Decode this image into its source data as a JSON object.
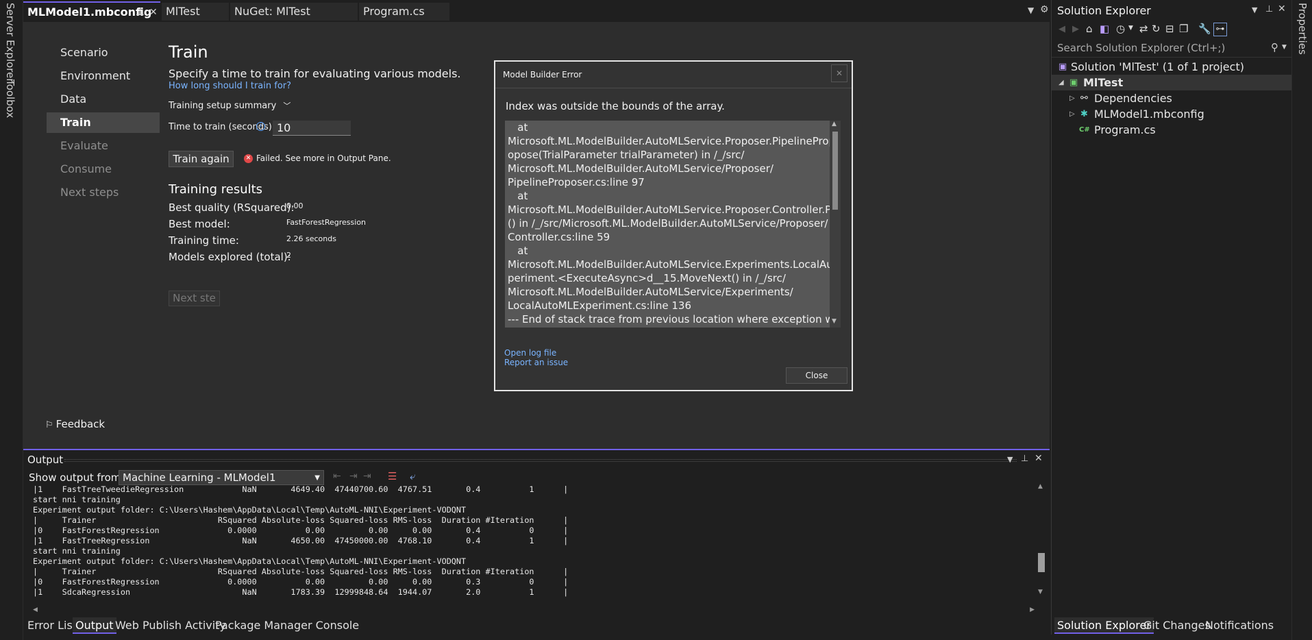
{
  "left_strip": {
    "server_explorer": "Server Explorer",
    "toolbox": "Toolbox"
  },
  "right_strip": {
    "properties": "Properties"
  },
  "doc_tabs": [
    {
      "label": "MLModel1.mbconfig"
    },
    {
      "label": "MlTest"
    },
    {
      "label": "NuGet: MlTest"
    },
    {
      "label": "Program.cs"
    }
  ],
  "nav": {
    "items": [
      "Scenario",
      "Environment",
      "Data",
      "Train",
      "Evaluate",
      "Consume",
      "Next steps"
    ]
  },
  "train": {
    "title": "Train",
    "subtitle": "Specify a time to train for evaluating various models.",
    "help_link": "How long should I train for?",
    "summary_toggle": "Training setup summary",
    "time_label": "Time to train (seconds):",
    "time_value": "10",
    "train_again": "Train again",
    "status": "Failed. See more in Output Pane.",
    "results_title": "Training results",
    "results": [
      {
        "label": "Best quality (RSquared):",
        "value": "0.00"
      },
      {
        "label": "Best model:",
        "value": "FastForestRegression"
      },
      {
        "label": "Training time:",
        "value": "2.26 seconds"
      },
      {
        "label": "Models explored (total):",
        "value": "2"
      }
    ],
    "next_step": "Next ste",
    "feedback": "Feedback"
  },
  "dialog": {
    "title": "Model Builder Error",
    "message": "Index was outside the bounds of the array.",
    "stack": "   at\nMicrosoft.ML.ModelBuilder.AutoMLService.Proposer.PipelineProposer.Pr\nopose(TrialParameter trialParameter) in /_/src/\nMicrosoft.ML.ModelBuilder.AutoMLService/Proposer/\nPipelineProposer.cs:line 97\n   at\nMicrosoft.ML.ModelBuilder.AutoMLService.Proposer.Controller.Propose\n() in /_/src/Microsoft.ML.ModelBuilder.AutoMLService/Proposer/\nController.cs:line 59\n   at\nMicrosoft.ML.ModelBuilder.AutoMLService.Experiments.LocalAutoMLEx\nperiment.<ExecuteAsync>d__15.MoveNext() in /_/src/\nMicrosoft.ML.ModelBuilder.AutoMLService/Experiments/\nLocalAutoMLExperiment.cs:line 136\n--- End of stack trace from previous location where exception was",
    "open_log": "Open log file",
    "report_issue": "Report an issue",
    "close": "Close"
  },
  "output": {
    "title": "Output",
    "show_from_label": "Show output from:",
    "source": "Machine Learning - MLModel1",
    "text": "|1    FastTreeTweedieRegression            NaN       4649.40  47440700.60  4767.51       0.4          1      |\nstart nni training\nExperiment output folder: C:\\Users\\Hashem\\AppData\\Local\\Temp\\AutoML-NNI\\Experiment-VODQNT\n|     Trainer                         RSquared Absolute-loss Squared-loss RMS-loss  Duration #Iteration      |\n|0    FastForestRegression              0.0000          0.00         0.00     0.00       0.4          0      |\n|1    FastTreeRegression                   NaN       4650.00  47450000.00  4768.10       0.4          1      |\nstart nni training\nExperiment output folder: C:\\Users\\Hashem\\AppData\\Local\\Temp\\AutoML-NNI\\Experiment-VODQNT\n|     Trainer                         RSquared Absolute-loss Squared-loss RMS-loss  Duration #Iteration      |\n|0    FastForestRegression              0.0000          0.00         0.00     0.00       0.3          0      |\n|1    SdcaRegression                       NaN       1783.39  12999848.64  1944.07       2.0          1      |"
  },
  "bottom_tabs": [
    "Error List",
    "Output",
    "Web Publish Activity",
    "Package Manager Console"
  ],
  "solution_explorer": {
    "title": "Solution Explorer",
    "search_placeholder": "Search Solution Explorer (Ctrl+;)",
    "solution": "Solution 'MlTest' (1 of 1 project)",
    "project": "MlTest",
    "items": [
      "Dependencies",
      "MLModel1.mbconfig",
      "Program.cs"
    ],
    "cs_glyph": "C#",
    "tabs": [
      "Solution Explorer",
      "Git Changes",
      "Notifications"
    ]
  }
}
